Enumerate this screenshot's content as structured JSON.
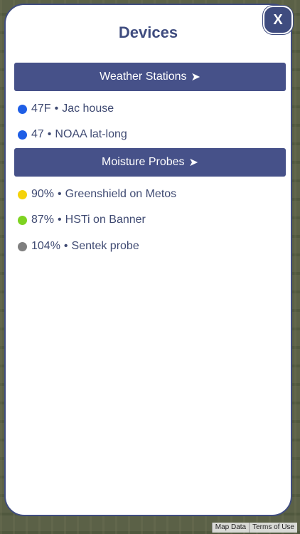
{
  "panel": {
    "title": "Devices",
    "close_label": "X"
  },
  "sections": [
    {
      "label": "Weather Stations",
      "arrow": "➤",
      "devices": [
        {
          "value": "47F",
          "separator": "•",
          "name": "Jac house",
          "color": "#1e5ee6"
        },
        {
          "value": "47",
          "separator": "•",
          "name": "NOAA lat-long",
          "color": "#1e5ee6"
        }
      ]
    },
    {
      "label": "Moisture Probes",
      "arrow": "➤",
      "devices": [
        {
          "value": "90%",
          "separator": "•",
          "name": "Greenshield on Metos",
          "color": "#f5d20a"
        },
        {
          "value": "87%",
          "separator": "•",
          "name": "HSTi on Banner",
          "color": "#7ed321"
        },
        {
          "value": "104%",
          "separator": "•",
          "name": "Sentek probe",
          "color": "#7f7f7f"
        }
      ]
    }
  ],
  "footer": {
    "map_data": "Map Data",
    "terms": "Terms of Use"
  }
}
